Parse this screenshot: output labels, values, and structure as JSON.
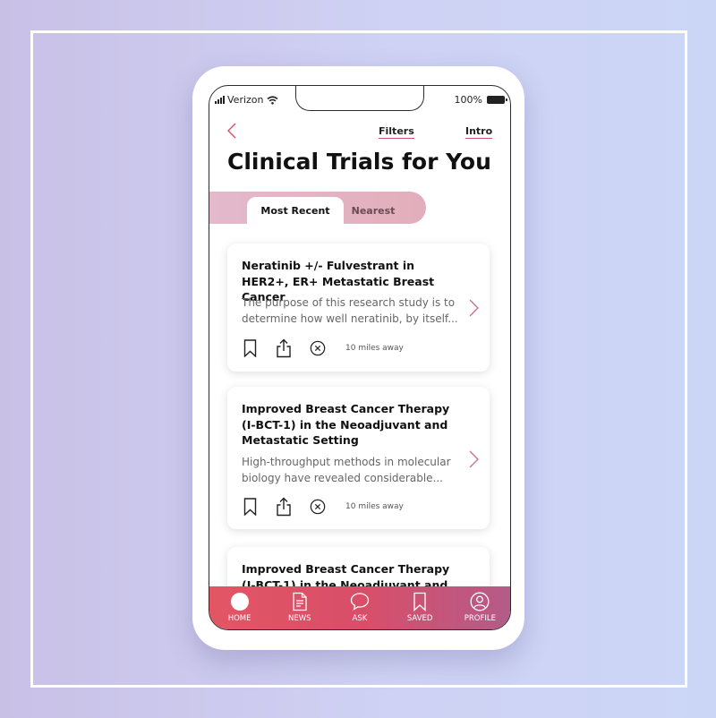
{
  "status": {
    "carrier": "Verizon",
    "battery": "100%"
  },
  "header": {
    "filters_label": "Filters",
    "intro_label": "Intro",
    "title": "Clinical Trials for You"
  },
  "tabs": [
    {
      "label": "Most Recent",
      "active": true
    },
    {
      "label": "Nearest",
      "active": false
    }
  ],
  "trials": [
    {
      "title": "Neratinib +/- Fulvestrant in HER2+, ER+ Metastatic Breast Cancer",
      "description": "The purpose of this research study is to determine how well neratinib, by itself...",
      "distance": "10 miles away"
    },
    {
      "title": "Improved Breast Cancer Therapy (I-BCT-1) in the Neoadjuvant and Metastatic Setting",
      "description": "High-throughput methods in molecular biology have revealed considerable...",
      "distance": "10 miles away"
    },
    {
      "title": "Improved Breast Cancer Therapy (I-BCT-1) in the Neoadjuvant and",
      "description": "",
      "distance": ""
    }
  ],
  "nav": [
    {
      "label": "HOME",
      "icon": "home-icon",
      "active": true
    },
    {
      "label": "NEWS",
      "icon": "news-icon",
      "active": false
    },
    {
      "label": "ASK",
      "icon": "chat-bubble-icon",
      "active": false
    },
    {
      "label": "SAVED",
      "icon": "bookmark-icon",
      "active": false
    },
    {
      "label": "PROFILE",
      "icon": "profile-icon",
      "active": false
    }
  ],
  "colors": {
    "accent": "#d9506b",
    "nav_start": "#e25664",
    "nav_end": "#b45b88",
    "tab_bg": "#e3b5c4"
  }
}
